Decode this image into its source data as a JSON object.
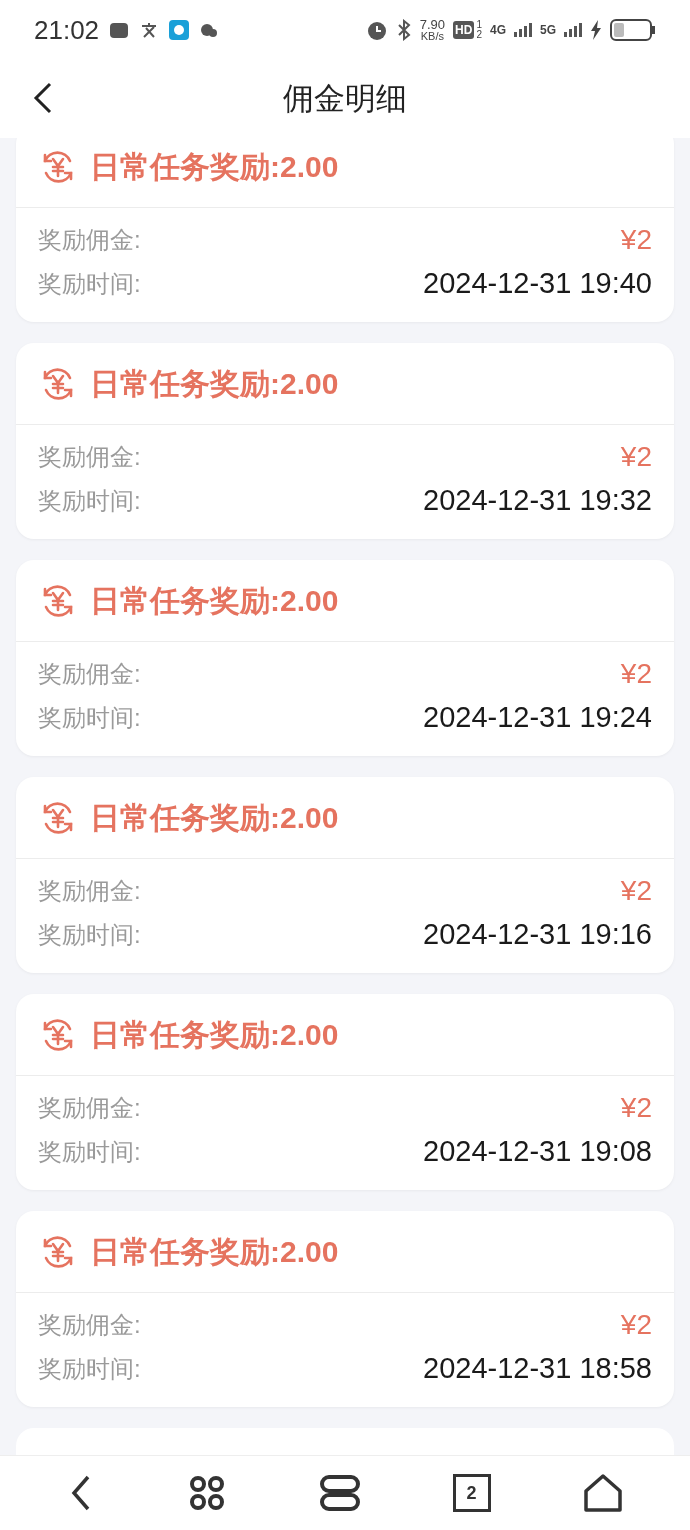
{
  "status_bar": {
    "time": "21:02",
    "speed": "7.90",
    "speed_unit": "KB/s",
    "hd": "HD",
    "sim_1": "1",
    "sim_2": "2",
    "net_1": "4G",
    "net_2": "5G"
  },
  "header": {
    "title": "佣金明细"
  },
  "records": [
    {
      "title": "日常任务奖励:2.00",
      "amount_label": "奖励佣金:",
      "amount": "¥2",
      "time_label": "奖励时间:",
      "time": "2024-12-31 19:40"
    },
    {
      "title": "日常任务奖励:2.00",
      "amount_label": "奖励佣金:",
      "amount": "¥2",
      "time_label": "奖励时间:",
      "time": "2024-12-31 19:32"
    },
    {
      "title": "日常任务奖励:2.00",
      "amount_label": "奖励佣金:",
      "amount": "¥2",
      "time_label": "奖励时间:",
      "time": "2024-12-31 19:24"
    },
    {
      "title": "日常任务奖励:2.00",
      "amount_label": "奖励佣金:",
      "amount": "¥2",
      "time_label": "奖励时间:",
      "time": "2024-12-31 19:16"
    },
    {
      "title": "日常任务奖励:2.00",
      "amount_label": "奖励佣金:",
      "amount": "¥2",
      "time_label": "奖励时间:",
      "time": "2024-12-31 19:08"
    },
    {
      "title": "日常任务奖励:2.00",
      "amount_label": "奖励佣金:",
      "amount": "¥2",
      "time_label": "奖励时间:",
      "time": "2024-12-31 18:58"
    }
  ],
  "nav_bar": {
    "tabs_count": "2"
  }
}
